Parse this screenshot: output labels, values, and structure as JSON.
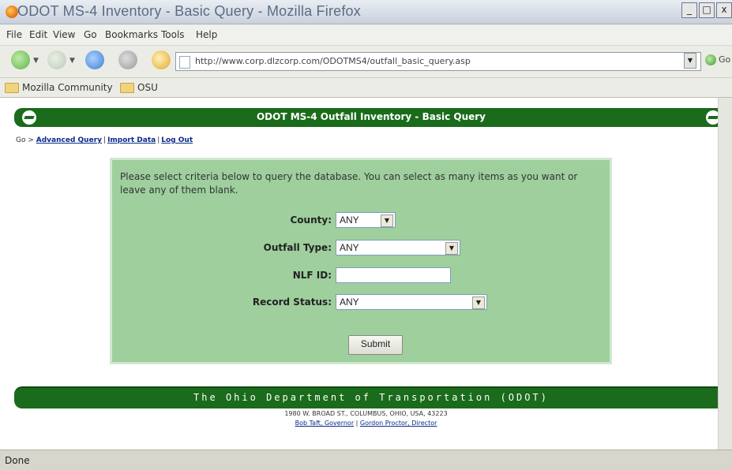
{
  "window": {
    "title": "ODOT MS-4 Inventory - Basic Query - Mozilla Firefox",
    "buttons": [
      "_",
      "□",
      "x"
    ]
  },
  "menu": [
    "File",
    "Edit",
    "View",
    "Go",
    "Bookmarks",
    "Tools",
    "Help"
  ],
  "nav": {
    "url": "http://www.corp.dlzcorp.com/ODOTMS4/outfall_basic_query.asp",
    "go_label": "Go"
  },
  "bookmarks": [
    "Mozilla Community",
    "OSU"
  ],
  "page": {
    "header_title": "ODOT MS-4 Outfall Inventory - Basic Query",
    "breadcrumb": {
      "prefix": "Go >",
      "links": [
        "Advanced Query",
        "Import Data",
        "Log Out"
      ]
    },
    "intro": "Please select criteria below to query the database. You can select as many items as you want or leave any of them blank.",
    "fields": {
      "county": {
        "label": "County:",
        "value": "ANY"
      },
      "outfall_type": {
        "label": "Outfall Type:",
        "value": "ANY"
      },
      "nlf_id": {
        "label": "NLF ID:",
        "value": ""
      },
      "record_status": {
        "label": "Record Status:",
        "value": "ANY"
      }
    },
    "submit_label": "Submit",
    "footer": {
      "title": "The Ohio Department of Transportation (ODOT)",
      "address": "1980 W. BROAD ST., COLUMBUS, OHIO, USA, 43223",
      "officials": [
        "Bob Taft, Governor",
        "Gordon Proctor, Director"
      ]
    }
  },
  "status": "Done",
  "colors": {
    "header_green": "#1a6b1b",
    "form_green": "#9ecf9d",
    "link_blue": "#0a2a8a"
  }
}
